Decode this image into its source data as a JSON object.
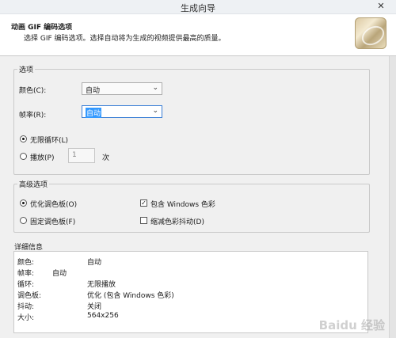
{
  "window": {
    "title": "生成向导",
    "close_glyph": "✕"
  },
  "header": {
    "title": "动画 GIF 编码选项",
    "description": "选择 GIF 编码选项。选择自动将为生成的视频提供最高的质量。",
    "icon": "gif-wizard-icon"
  },
  "options": {
    "legend": "选项",
    "color_label": "颜色(C):",
    "color_value": "自动",
    "framerate_label": "帧率(R):",
    "framerate_value": "自动",
    "loop_infinite_label": "无限循环(L)",
    "play_label": "播放(P)",
    "play_count": "1",
    "play_unit": "次",
    "selected": "loop_infinite"
  },
  "advanced": {
    "legend": "高级选项",
    "optimize_palette_label": "优化调色板(O)",
    "fixed_palette_label": "固定调色板(F)",
    "include_windows_label": "包含 Windows 色彩",
    "reduce_dither_label": "缩减色彩抖动(D)",
    "include_windows_checked": true,
    "reduce_dither_checked": false,
    "selected": "optimize_palette"
  },
  "details": {
    "legend": "详细信息",
    "rows": [
      {
        "key": "颜色:",
        "value": "自动"
      },
      {
        "key": "帧率:",
        "value": "自动"
      },
      {
        "key": "循环:",
        "value": "无限播放"
      },
      {
        "key": "调色板:",
        "value": "优化 (包含 Windows 色彩)"
      },
      {
        "key": "抖动:",
        "value": "关闭"
      },
      {
        "key": "大小:",
        "value": "564x256"
      }
    ]
  },
  "watermark": "Baidu 经验"
}
